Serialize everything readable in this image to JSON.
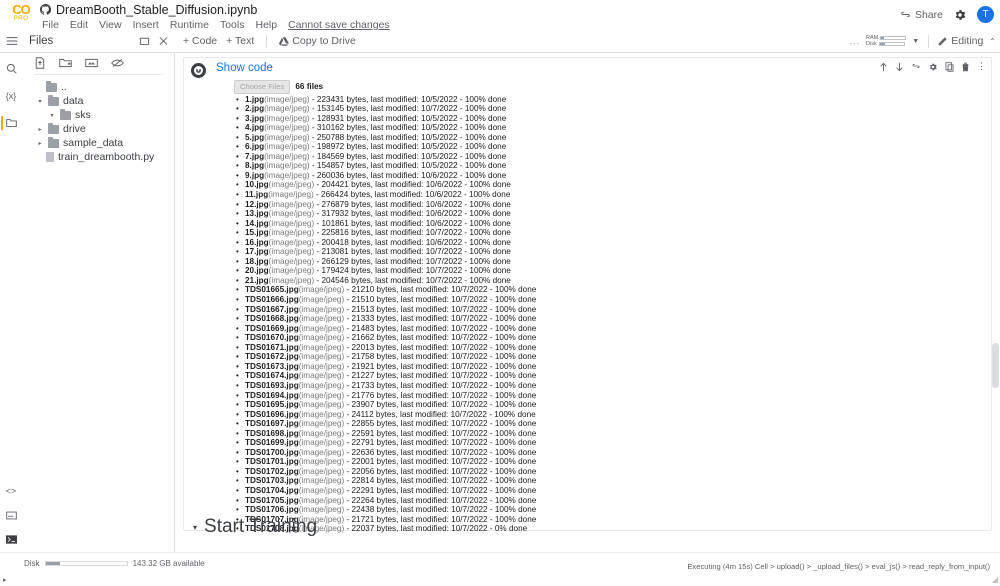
{
  "app": {
    "logo_mark": "CO",
    "logo_sub": "PRO",
    "notebook_title": "DreamBooth_Stable_Diffusion.ipynb",
    "menus": [
      "File",
      "Edit",
      "View",
      "Insert",
      "Runtime",
      "Tools",
      "Help"
    ],
    "save_state": "Cannot save changes",
    "share_label": "Share",
    "avatar_initial": "T"
  },
  "toolbar": {
    "add_code": "+ Code",
    "add_text": "+ Text",
    "copy_to_drive": "Copy to Drive",
    "ram_label": "RAM",
    "disk_label": "Disk",
    "editing_label": "Editing",
    "more_options": "...",
    "collapse_icon": "chevron-up"
  },
  "sidebar": {
    "panel_title": "Files",
    "rail_icons": [
      "search-icon",
      "variables-icon",
      "files-icon"
    ],
    "rail_bottom_icons": [
      "code-snippets-icon",
      "terminal-panel-icon",
      "terminal-icon"
    ],
    "action_icons": [
      "upload-file-icon",
      "new-folder-icon",
      "mount-drive-icon",
      "refresh-hidden-icon"
    ],
    "tree": [
      {
        "label": "..",
        "type": "parent",
        "arrow": "",
        "indent": 0
      },
      {
        "label": "data",
        "type": "folder",
        "arrow": "▾",
        "indent": 0
      },
      {
        "label": "sks",
        "type": "folder",
        "arrow": "▾",
        "indent": 1
      },
      {
        "label": "drive",
        "type": "folder",
        "arrow": "▸",
        "indent": 0
      },
      {
        "label": "sample_data",
        "type": "folder",
        "arrow": "▸",
        "indent": 0
      },
      {
        "label": "train_dreambooth.py",
        "type": "file",
        "arrow": "",
        "indent": 0
      }
    ]
  },
  "cell": {
    "show_code": "Show code",
    "choose_files_button": "Choose Files",
    "file_count": "66 files",
    "tool_icons": [
      "move-up-icon",
      "move-down-icon",
      "link-icon",
      "settings-icon",
      "copy-icon",
      "delete-icon",
      "more-vert-icon"
    ],
    "uploads": [
      {
        "name": "1.jpg",
        "mime": "(image/jpeg)",
        "detail": "- 223431 bytes, last modified: 10/5/2022 - 100% done"
      },
      {
        "name": "2.jpg",
        "mime": "(image/jpeg)",
        "detail": "- 153145 bytes, last modified: 10/7/2022 - 100% done"
      },
      {
        "name": "3.jpg",
        "mime": "(image/jpeg)",
        "detail": "- 128931 bytes, last modified: 10/5/2022 - 100% done"
      },
      {
        "name": "4.jpg",
        "mime": "(image/jpeg)",
        "detail": "- 310162 bytes, last modified: 10/5/2022 - 100% done"
      },
      {
        "name": "5.jpg",
        "mime": "(image/jpeg)",
        "detail": "- 250788 bytes, last modified: 10/5/2022 - 100% done"
      },
      {
        "name": "6.jpg",
        "mime": "(image/jpeg)",
        "detail": "- 198972 bytes, last modified: 10/5/2022 - 100% done"
      },
      {
        "name": "7.jpg",
        "mime": "(image/jpeg)",
        "detail": "- 184569 bytes, last modified: 10/5/2022 - 100% done"
      },
      {
        "name": "8.jpg",
        "mime": "(image/jpeg)",
        "detail": "- 154857 bytes, last modified: 10/5/2022 - 100% done"
      },
      {
        "name": "9.jpg",
        "mime": "(image/jpeg)",
        "detail": "- 260036 bytes, last modified: 10/6/2022 - 100% done"
      },
      {
        "name": "10.jpg",
        "mime": "(image/jpeg)",
        "detail": "- 204421 bytes, last modified: 10/6/2022 - 100% done"
      },
      {
        "name": "11.jpg",
        "mime": "(image/jpeg)",
        "detail": "- 266424 bytes, last modified: 10/6/2022 - 100% done"
      },
      {
        "name": "12.jpg",
        "mime": "(image/jpeg)",
        "detail": "- 276879 bytes, last modified: 10/6/2022 - 100% done"
      },
      {
        "name": "13.jpg",
        "mime": "(image/jpeg)",
        "detail": "- 317932 bytes, last modified: 10/6/2022 - 100% done"
      },
      {
        "name": "14.jpg",
        "mime": "(image/jpeg)",
        "detail": "- 101861 bytes, last modified: 10/6/2022 - 100% done"
      },
      {
        "name": "15.jpg",
        "mime": "(image/jpeg)",
        "detail": "- 225816 bytes, last modified: 10/7/2022 - 100% done"
      },
      {
        "name": "16.jpg",
        "mime": "(image/jpeg)",
        "detail": "- 200418 bytes, last modified: 10/6/2022 - 100% done"
      },
      {
        "name": "17.jpg",
        "mime": "(image/jpeg)",
        "detail": "- 213081 bytes, last modified: 10/7/2022 - 100% done"
      },
      {
        "name": "18.jpg",
        "mime": "(image/jpeg)",
        "detail": "- 266129 bytes, last modified: 10/7/2022 - 100% done"
      },
      {
        "name": "20.jpg",
        "mime": "(image/jpeg)",
        "detail": "- 179424 bytes, last modified: 10/7/2022 - 100% done"
      },
      {
        "name": "21.jpg",
        "mime": "(image/jpeg)",
        "detail": "- 204546 bytes, last modified: 10/7/2022 - 100% done"
      },
      {
        "name": "TDS01665.jpg",
        "mime": "(image/jpeg)",
        "detail": "- 21210 bytes, last modified: 10/7/2022 - 100% done"
      },
      {
        "name": "TDS01666.jpg",
        "mime": "(image/jpeg)",
        "detail": "- 21510 bytes, last modified: 10/7/2022 - 100% done"
      },
      {
        "name": "TDS01667.jpg",
        "mime": "(image/jpeg)",
        "detail": "- 21513 bytes, last modified: 10/7/2022 - 100% done"
      },
      {
        "name": "TDS01668.jpg",
        "mime": "(image/jpeg)",
        "detail": "- 21333 bytes, last modified: 10/7/2022 - 100% done"
      },
      {
        "name": "TDS01669.jpg",
        "mime": "(image/jpeg)",
        "detail": "- 21483 bytes, last modified: 10/7/2022 - 100% done"
      },
      {
        "name": "TDS01670.jpg",
        "mime": "(image/jpeg)",
        "detail": "- 21662 bytes, last modified: 10/7/2022 - 100% done"
      },
      {
        "name": "TDS01671.jpg",
        "mime": "(image/jpeg)",
        "detail": "- 22013 bytes, last modified: 10/7/2022 - 100% done"
      },
      {
        "name": "TDS01672.jpg",
        "mime": "(image/jpeg)",
        "detail": "- 21758 bytes, last modified: 10/7/2022 - 100% done"
      },
      {
        "name": "TDS01673.jpg",
        "mime": "(image/jpeg)",
        "detail": "- 21921 bytes, last modified: 10/7/2022 - 100% done"
      },
      {
        "name": "TDS01674.jpg",
        "mime": "(image/jpeg)",
        "detail": "- 21227 bytes, last modified: 10/7/2022 - 100% done"
      },
      {
        "name": "TDS01693.jpg",
        "mime": "(image/jpeg)",
        "detail": "- 21733 bytes, last modified: 10/7/2022 - 100% done"
      },
      {
        "name": "TDS01694.jpg",
        "mime": "(image/jpeg)",
        "detail": "- 21776 bytes, last modified: 10/7/2022 - 100% done"
      },
      {
        "name": "TDS01695.jpg",
        "mime": "(image/jpeg)",
        "detail": "- 23907 bytes, last modified: 10/7/2022 - 100% done"
      },
      {
        "name": "TDS01696.jpg",
        "mime": "(image/jpeg)",
        "detail": "- 24112 bytes, last modified: 10/7/2022 - 100% done"
      },
      {
        "name": "TDS01697.jpg",
        "mime": "(image/jpeg)",
        "detail": "- 22855 bytes, last modified: 10/7/2022 - 100% done"
      },
      {
        "name": "TDS01698.jpg",
        "mime": "(image/jpeg)",
        "detail": "- 22591 bytes, last modified: 10/7/2022 - 100% done"
      },
      {
        "name": "TDS01699.jpg",
        "mime": "(image/jpeg)",
        "detail": "- 22791 bytes, last modified: 10/7/2022 - 100% done"
      },
      {
        "name": "TDS01700.jpg",
        "mime": "(image/jpeg)",
        "detail": "- 22636 bytes, last modified: 10/7/2022 - 100% done"
      },
      {
        "name": "TDS01701.jpg",
        "mime": "(image/jpeg)",
        "detail": "- 22001 bytes, last modified: 10/7/2022 - 100% done"
      },
      {
        "name": "TDS01702.jpg",
        "mime": "(image/jpeg)",
        "detail": "- 22056 bytes, last modified: 10/7/2022 - 100% done"
      },
      {
        "name": "TDS01703.jpg",
        "mime": "(image/jpeg)",
        "detail": "- 22814 bytes, last modified: 10/7/2022 - 100% done"
      },
      {
        "name": "TDS01704.jpg",
        "mime": "(image/jpeg)",
        "detail": "- 22291 bytes, last modified: 10/7/2022 - 100% done"
      },
      {
        "name": "TDS01705.jpg",
        "mime": "(image/jpeg)",
        "detail": "- 22264 bytes, last modified: 10/7/2022 - 100% done"
      },
      {
        "name": "TDS01706.jpg",
        "mime": "(image/jpeg)",
        "detail": "- 22438 bytes, last modified: 10/7/2022 - 100% done"
      },
      {
        "name": "TDS01707.jpg",
        "mime": "(image/jpeg)",
        "detail": "- 21721 bytes, last modified: 10/7/2022 - 100% done"
      },
      {
        "name": "TDS01708.jpg",
        "mime": "(image/jpeg)",
        "detail": "- 22037 bytes, last modified: 10/7/2022 - 0% done"
      }
    ]
  },
  "section": {
    "start_training": "Start Training",
    "collapse_arrow": "▾"
  },
  "status": {
    "disk_label": "Disk",
    "disk_available": "143.32 GB available",
    "executing": "Executing (4m 15s) Cell > upload() > _upload_files() > eval_js() > read_reply_from_input()"
  },
  "colors": {
    "accent": "#f9ab00",
    "link": "#1a73e8",
    "avatar": "#1a73e8",
    "muted": "#5f6368"
  }
}
